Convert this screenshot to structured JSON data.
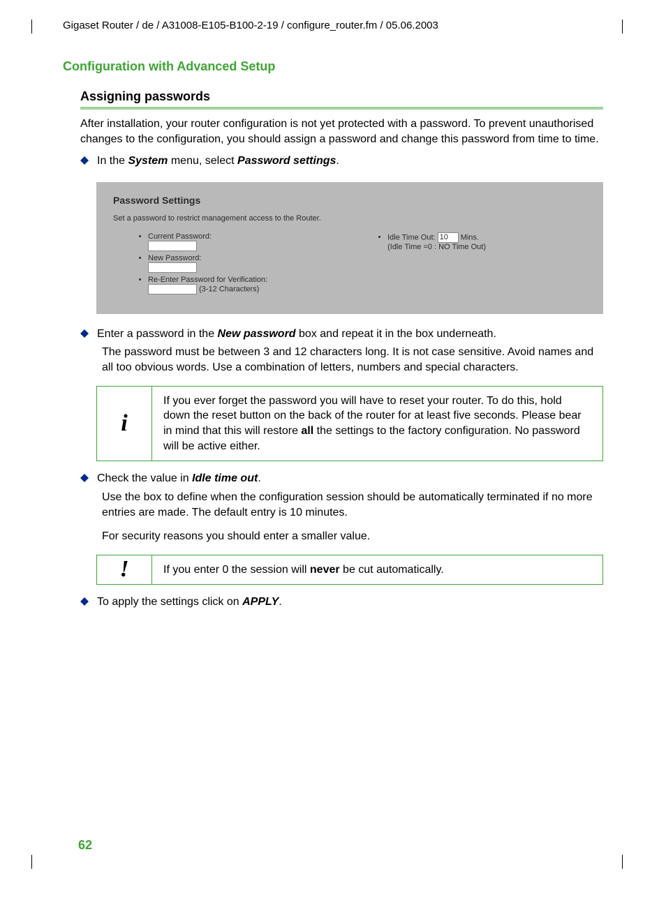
{
  "header": "Gigaset Router / de / A31008-E105-B100-2-19 / configure_router.fm / 05.06.2003",
  "h1": "Configuration with Advanced Setup",
  "h2": "Assigning passwords",
  "intro": "After installation, your router configuration is not yet protected with a password. To prevent unauthorised changes to the configuration, you should assign a password and change this password from time to time.",
  "bullet1": {
    "pre": "In the ",
    "b1": "System",
    "mid": " menu, select ",
    "b2": "Password settings",
    "post": "."
  },
  "shot": {
    "title": "Password Settings",
    "sub": "Set a password to restrict management access to the Router.",
    "l1": "Current Password:",
    "l2": "New Password:",
    "l3": "Re-Enter Password for Verification:",
    "hint": "(3-12 Characters)",
    "r1a": "Idle Time Out:",
    "r1val": "10",
    "r1b": "Mins.",
    "r2": "(Idle Time =0 : NO Time Out)"
  },
  "bullet2": {
    "pre": "Enter a password in the ",
    "b1": "New password",
    "post": " box and repeat it in the box underneath."
  },
  "para2": "The password must be between 3 and 12 characters long. It is not case sensitive. Avoid names and all too obvious words. Use a combination of letters, numbers and special characters.",
  "info1": {
    "icon": "i",
    "t1": "If you ever forget the password you will have to reset your router. To do this, hold down the reset button on the back of the router for at least five seconds. Please bear in mind that this will restore ",
    "b": "all",
    "t2": " the settings to the factory configuration. No password will be active either."
  },
  "bullet3": {
    "pre": "Check the value in ",
    "b1": "Idle time out",
    "post": "."
  },
  "para3a": "Use the box to define when the configuration session should be automatically terminated if no more entries are made. The default entry is 10 minutes.",
  "para3b": "For security reasons you should enter a smaller value.",
  "info2": {
    "icon": "!",
    "t1": "If you enter 0 the session will ",
    "b": "never",
    "t2": " be cut automatically."
  },
  "bullet4": {
    "pre": "To apply the settings click on ",
    "b1": "APPLY",
    "post": "."
  },
  "pageNumber": "62"
}
